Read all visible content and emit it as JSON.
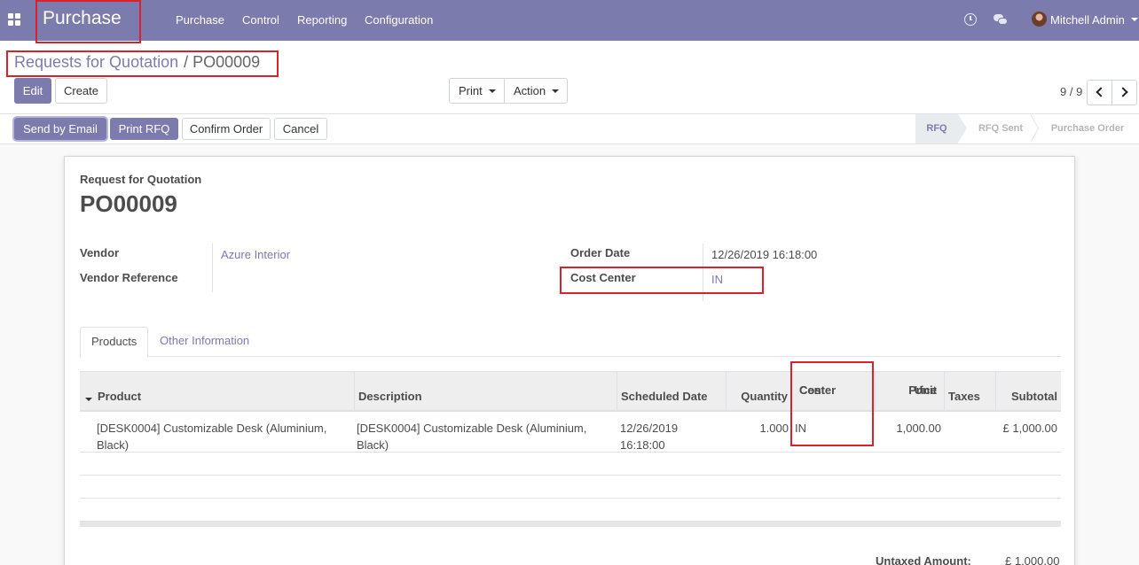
{
  "topbar": {
    "app_name": "Purchase",
    "menu": [
      "Purchase",
      "Control",
      "Reporting",
      "Configuration"
    ],
    "user_name": "Mitchell Admin"
  },
  "breadcrumb": {
    "parent": "Requests for Quotation",
    "separator": "/",
    "current": "PO00009"
  },
  "control": {
    "edit_label": "Edit",
    "create_label": "Create",
    "print_label": "Print",
    "action_label": "Action",
    "pager_value": "9 / 9"
  },
  "statusbar": {
    "buttons": [
      "Send by Email",
      "Print RFQ",
      "Confirm Order",
      "Cancel"
    ],
    "stages": [
      "RFQ",
      "RFQ Sent",
      "Purchase Order"
    ],
    "active_stage": "RFQ"
  },
  "sheet": {
    "doc_type": "Request for Quotation",
    "doc_name": "PO00009",
    "fields": {
      "vendor_label": "Vendor",
      "vendor_value": "Azure Interior",
      "vendor_ref_label": "Vendor Reference",
      "vendor_ref_value": "",
      "order_date_label": "Order Date",
      "order_date_value": "12/26/2019 16:18:00",
      "cost_center_label": "Cost Center",
      "cost_center_value": "IN"
    },
    "tabs": [
      "Products",
      "Other Information"
    ],
    "table": {
      "headers": {
        "product": "Product",
        "description": "Description",
        "scheduled_date": "Scheduled Date",
        "quantity": "Quantity",
        "cost_center_1": "Cost",
        "cost_center_2": "Center",
        "unit_price_1": "Unit",
        "unit_price_2": "Price",
        "taxes": "Taxes",
        "subtotal": "Subtotal"
      },
      "rows": [
        {
          "product_1": "[DESK0004] Customizable Desk (Aluminium,",
          "product_2": "Black)",
          "description_1": "[DESK0004] Customizable Desk (Aluminium,",
          "description_2": "Black)",
          "scheduled_1": "12/26/2019",
          "scheduled_2": "16:18:00",
          "quantity": "1.000",
          "cost_center": "IN",
          "unit_price": "1,000.00",
          "taxes": "",
          "subtotal": "£ 1,000.00"
        }
      ]
    },
    "totals": {
      "untaxed_label": "Untaxed Amount:",
      "untaxed_value": "£ 1,000.00"
    }
  },
  "colors": {
    "brand": "#7c7bad",
    "highlight": "#d9222b"
  }
}
